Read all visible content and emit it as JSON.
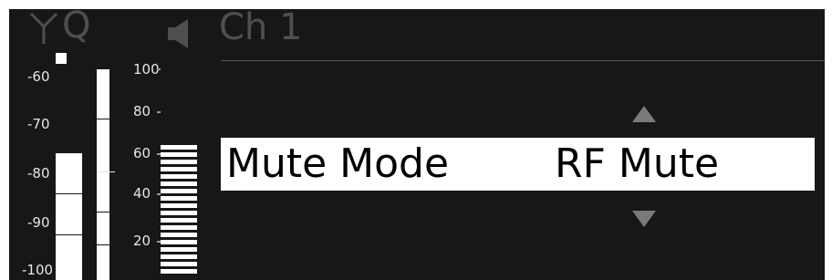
{
  "status_bar": {
    "antenna_icon": "antenna-icon",
    "diversity_letter": "Q",
    "speaker_icon": "speaker-icon",
    "channel_name": "Ch 1"
  },
  "rf_meter": {
    "scale_labels": [
      "-60",
      "-70",
      "-80",
      "-90",
      "-100"
    ],
    "level_dbm": -76,
    "peak_hold": true
  },
  "af_meter": {
    "level_fraction": 1.0
  },
  "level_meter": {
    "scale_labels": [
      "100",
      "80",
      "60",
      "40",
      "20"
    ],
    "level": 64
  },
  "menu": {
    "label": "Mute Mode",
    "value": "RF Mute",
    "scroll_up_icon": "triangle-up-icon",
    "scroll_down_icon": "triangle-down-icon"
  },
  "colors": {
    "screen_background": "#171717",
    "foreground": "#ffffff",
    "dim": "#4f4f4f"
  }
}
